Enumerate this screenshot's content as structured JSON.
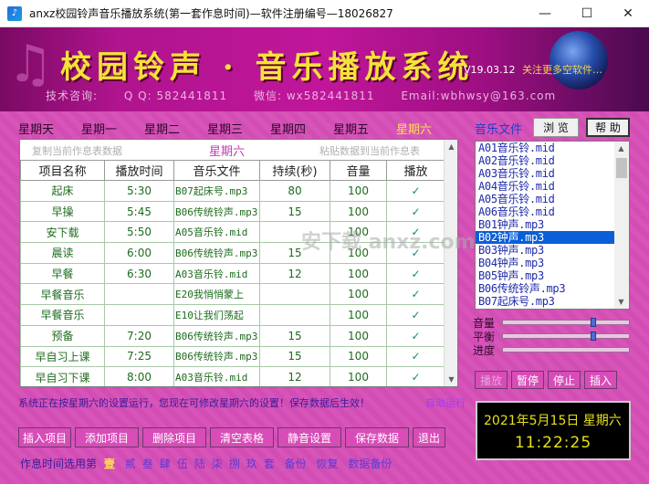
{
  "window": {
    "title": "anxz校园铃声音乐播放系统(第一套作息时间)—软件注册编号—18026827",
    "min_glyph": "—",
    "max_glyph": "☐",
    "close_glyph": "✕"
  },
  "banner": {
    "title": "校园铃声 · 音乐播放系统",
    "version": "V19.03.12",
    "follow": "关注更多空软件…",
    "tech": "技术咨询:",
    "qq": "Q Q: 582441811",
    "wechat": "微信: wx582441811",
    "email": "Email:wbhwsy@163.com"
  },
  "day_tabs": [
    "星期天",
    "星期一",
    "星期二",
    "星期三",
    "星期四",
    "星期五",
    "星期六"
  ],
  "active_day": "星期六",
  "schedule": {
    "copy_link": "复制当前作息表数据",
    "day_label": "星期六",
    "paste_link": "粘贴数据到当前作息表",
    "columns": [
      "项目名称",
      "播放时间",
      "音乐文件",
      "持续(秒)",
      "音量",
      "播放"
    ],
    "rows": [
      {
        "name": "起床",
        "time": "5:30",
        "file": "B07起床号.mp3",
        "duration": "80",
        "volume": "100",
        "play": "✓"
      },
      {
        "name": "早操",
        "time": "5:45",
        "file": "B06传统铃声.mp3",
        "duration": "15",
        "volume": "100",
        "play": "✓"
      },
      {
        "name": "安下载",
        "time": "5:50",
        "file": "A05音乐铃.mid",
        "duration": "",
        "volume": "100",
        "play": "✓"
      },
      {
        "name": "晨读",
        "time": "6:00",
        "file": "B06传统铃声.mp3",
        "duration": "15",
        "volume": "100",
        "play": "✓"
      },
      {
        "name": "早餐",
        "time": "6:30",
        "file": "A03音乐铃.mid",
        "duration": "12",
        "volume": "100",
        "play": "✓"
      },
      {
        "name": "早餐音乐",
        "time": "",
        "file": "E20我悄悄蒙上",
        "duration": "",
        "volume": "100",
        "play": "✓"
      },
      {
        "name": "早餐音乐",
        "time": "",
        "file": "E10让我们荡起",
        "duration": "",
        "volume": "100",
        "play": "✓"
      },
      {
        "name": "预备",
        "time": "7:20",
        "file": "B06传统铃声.mp3",
        "duration": "15",
        "volume": "100",
        "play": "✓"
      },
      {
        "name": "早自习上课",
        "time": "7:25",
        "file": "B06传统铃声.mp3",
        "duration": "15",
        "volume": "100",
        "play": "✓"
      },
      {
        "name": "早自习下课",
        "time": "8:00",
        "file": "A03音乐铃.mid",
        "duration": "12",
        "volume": "100",
        "play": "✓"
      }
    ]
  },
  "status": {
    "message": "系统正在按星期六的设置运行，您现在可修改星期六的设置！保存数据后生效！",
    "right": "自动运行"
  },
  "buttons": [
    "插入项目",
    "添加项目",
    "删除项目",
    "清空表格",
    "静音设置",
    "保存数据",
    "退出"
  ],
  "time_select": {
    "label": "作息时间选用第",
    "selected": "壹",
    "options": [
      "贰",
      "叁",
      "肆",
      "伍",
      "陆",
      "柒",
      "捌",
      "玖",
      "套"
    ],
    "extra1": "备份",
    "extra2": "恢复",
    "extra3": "数据备份"
  },
  "music": {
    "label": "音乐文件",
    "browse": "浏 览",
    "help": "帮 助",
    "files": [
      "A01音乐铃.mid",
      "A02音乐铃.mid",
      "A03音乐铃.mid",
      "A04音乐铃.mid",
      "A05音乐铃.mid",
      "A06音乐铃.mid",
      "B01钟声.mp3",
      "B02钟声.mp3",
      "B03钟声.mp3",
      "B04钟声.mp3",
      "B05钟声.mp3",
      "B06传统铃声.mp3",
      "B07起床号.mp3"
    ],
    "selected_index": 7
  },
  "sliders": {
    "volume_label": "音量",
    "balance_label": "平衡",
    "progress_label": "进度",
    "volume_level": 0.72,
    "balance_level": 0.72,
    "progress_level": 0.0
  },
  "player": {
    "play": "播放",
    "pause": "暂停",
    "stop": "停止",
    "insert": "插入"
  },
  "clock": {
    "date": "2021年5月15日  星期六",
    "time": "11:22:25"
  },
  "watermark": "安下载 anxz.com",
  "colors": {
    "panel": "#d64fb7",
    "banner_title": "#f5e23a",
    "active_tab": "#ffe04a",
    "selected_file": "#0a5ed8"
  }
}
